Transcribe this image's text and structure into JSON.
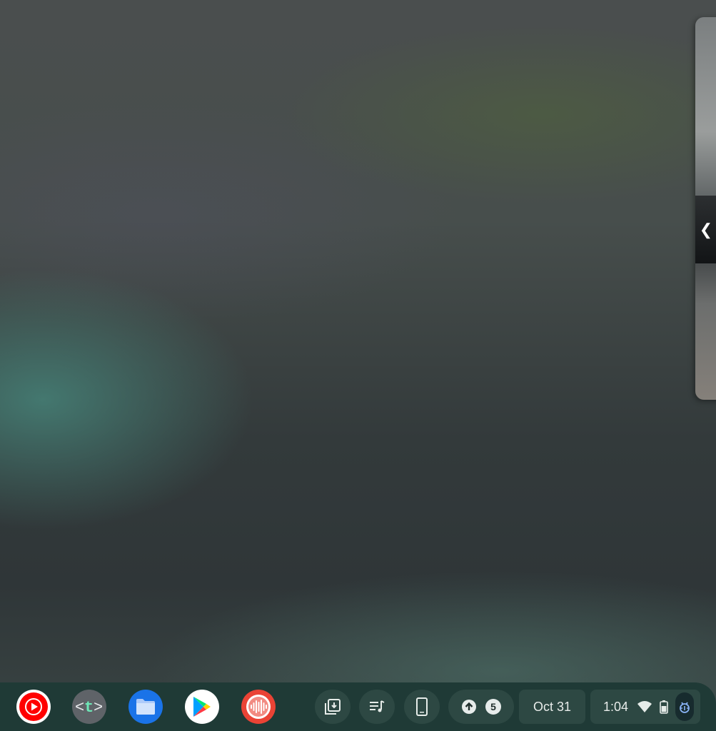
{
  "pip_window": {
    "collapse_icon": "chevron-left-icon",
    "collapse_glyph": "❮"
  },
  "shelf": {
    "apps": [
      {
        "name": "YouTube Music",
        "icon": "youtube-music-icon",
        "color": "#ff0000"
      },
      {
        "name": "Terminal",
        "icon": "terminal-icon",
        "label": "<t>",
        "color": "#5f6368"
      },
      {
        "name": "Files",
        "icon": "files-icon",
        "color": "#1a73e8"
      },
      {
        "name": "Play Store",
        "icon": "play-store-icon",
        "color": "#ffffff"
      },
      {
        "name": "Recorder",
        "icon": "recorder-icon",
        "color": "#ea4335"
      }
    ],
    "tray": {
      "holding_space_icon": "holding-space-icon",
      "media_controls_icon": "media-playlist-icon",
      "phone_hub_icon": "phone-hub-icon",
      "notification_up_icon": "upload-icon",
      "notification_count": "5",
      "date": "Oct 31",
      "time": "1:04",
      "wifi_icon": "wifi-icon",
      "battery_icon": "battery-icon",
      "accessibility_icon": "bug-icon"
    }
  },
  "colors": {
    "shelf_bg": "#1f3a36",
    "pod_bg": "#2d4843",
    "accent": "#8ab4f8"
  }
}
